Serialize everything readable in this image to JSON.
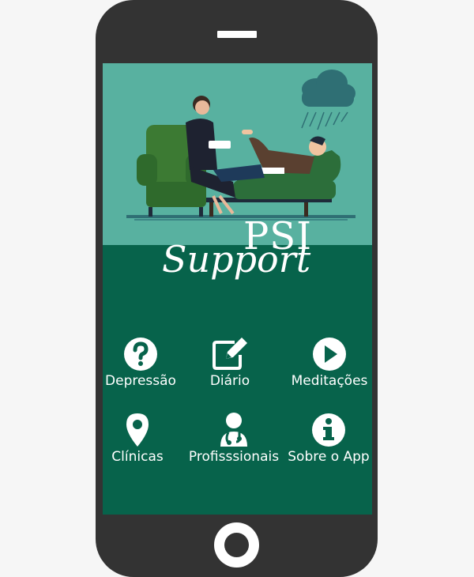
{
  "app": {
    "logo_top": "PSI",
    "logo_bottom": "Support"
  },
  "menu": [
    {
      "label": "Depressão",
      "icon": "question-circle-icon"
    },
    {
      "label": "Diário",
      "icon": "edit-icon"
    },
    {
      "label": "Meditações",
      "icon": "play-circle-icon"
    },
    {
      "label": "Clínicas",
      "icon": "map-pin-icon"
    },
    {
      "label": "Profisssionais",
      "icon": "doctor-icon"
    },
    {
      "label": "Sobre o App",
      "icon": "info-circle-icon"
    }
  ],
  "colors": {
    "screen_bg": "#07634b",
    "hero_bg": "#58b1a0",
    "phone": "#333333",
    "text": "#ffffff"
  }
}
